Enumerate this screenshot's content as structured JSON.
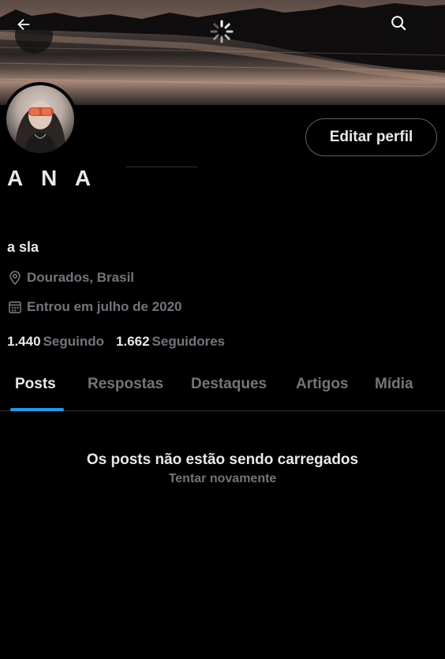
{
  "header": {
    "back_icon": "arrow-left-icon",
    "search_icon": "search-icon",
    "loading_icon": "spinner-icon"
  },
  "profile": {
    "name": "A N A",
    "bio": "a sla",
    "location": "Dourados, Brasil",
    "joined": "Entrou em julho de 2020",
    "following_count": "1.440",
    "following_label": "Seguindo",
    "followers_count": "1.662",
    "followers_label": "Seguidores"
  },
  "actions": {
    "edit_profile_label": "Editar perfil"
  },
  "tabs": [
    {
      "label": "Posts",
      "active": true
    },
    {
      "label": "Respostas",
      "active": false
    },
    {
      "label": "Destaques",
      "active": false
    },
    {
      "label": "Artigos",
      "active": false
    },
    {
      "label": "Mídia",
      "active": false
    }
  ],
  "feed": {
    "empty_message": "Os posts não estão sendo carregados",
    "retry_label": "Tentar novamente"
  },
  "colors": {
    "accent": "#1d9bf0",
    "text_primary": "#e7e9ea",
    "text_secondary": "#71767b",
    "background": "#000000"
  }
}
